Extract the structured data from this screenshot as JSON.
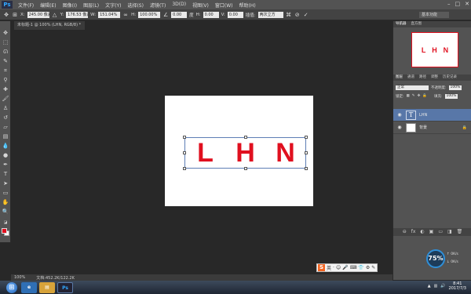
{
  "app": {
    "logo": "Ps"
  },
  "menu": [
    "文件(F)",
    "编辑(E)",
    "图像(I)",
    "图层(L)",
    "文字(Y)",
    "选择(S)",
    "滤镜(T)",
    "3D(D)",
    "视图(V)",
    "窗口(W)",
    "帮助(H)"
  ],
  "window_controls": {
    "minimize": "–",
    "maximize": "□",
    "close": "✕"
  },
  "options": {
    "x_label": "X:",
    "x_value": "245.00 像素",
    "y_label": "Y:",
    "y_value": "176.53 像素",
    "w_label": "W:",
    "w_value": "151.04%",
    "h_label": "H:",
    "h_value": "100.00%",
    "angle_value": "0.00",
    "angle_unit": "度",
    "hskew_label": "H:",
    "hskew_value": "0.00",
    "vskew_label": "V:",
    "vskew_value": "0.00",
    "interp_label": "插值:",
    "interp_value": "两次立方",
    "workspace": "基本功能"
  },
  "document_tab": "未标题-1 @ 100% (LHN, RGB/8) *",
  "canvas": {
    "letters": [
      "L",
      "H",
      "N"
    ],
    "text_color": "#e0101f"
  },
  "status": {
    "zoom": "100%",
    "doc_info": "文档:452.2K/122.2K"
  },
  "panels": {
    "top_tabs": [
      "导航器",
      "直方图"
    ],
    "layer_tabs": [
      "图层",
      "通道",
      "路径",
      "调整",
      "历史记录"
    ],
    "blend_mode": "正常",
    "opacity_label": "不透明度:",
    "opacity_value": "100%",
    "lock_label": "锁定:",
    "fill_label": "填充:",
    "fill_value": "100%",
    "layers": [
      {
        "name": "LHN",
        "thumb": "T",
        "selected": true
      },
      {
        "name": "背景",
        "thumb": "",
        "selected": false
      }
    ],
    "footer_icons": [
      "⊖",
      "fx",
      "◐",
      "▣",
      "▭",
      "◨",
      "🗑"
    ]
  },
  "ime_bar": {
    "logo": "S",
    "items": [
      "英",
      "·",
      "☺",
      "🎤",
      "⌨",
      "👕",
      "⚙",
      "✎"
    ]
  },
  "speed_widget": {
    "percent": "75%",
    "up": "0K/s",
    "down": "0K/s"
  },
  "taskbar": {
    "apps": [
      "e",
      "▤",
      "Ps"
    ],
    "time": "8:41",
    "date": "2017/7/3"
  }
}
